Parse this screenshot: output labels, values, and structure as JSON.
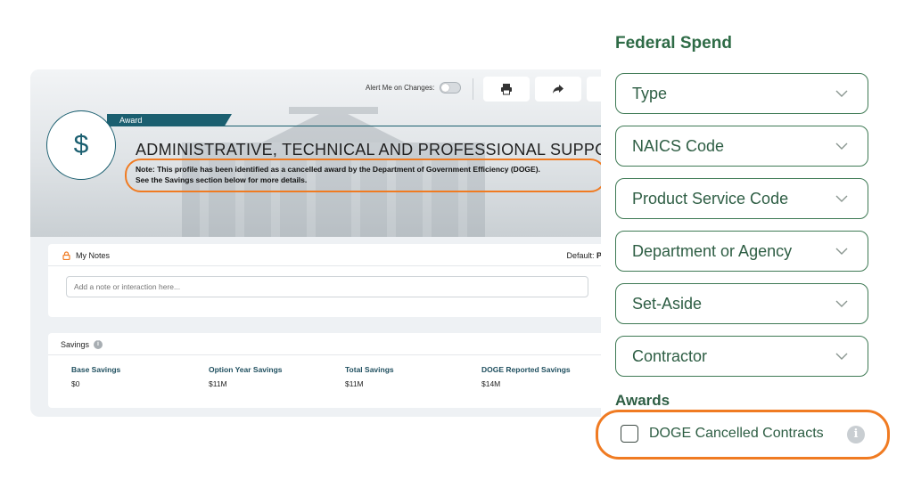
{
  "profile": {
    "alert_label": "Alert Me on Changes:",
    "award_tab": "Award",
    "currency_symbol": "$",
    "title": "ADMINISTRATIVE, TECHNICAL AND PROFESSIONAL SUPPORT FOR",
    "note_line1": "Note: This profile has been identified as a cancelled award by the Department of Government Efficiency (DOGE).",
    "note_line2": "See the Savings section below for more details."
  },
  "notes": {
    "title": "My Notes",
    "default_label": "Default: ",
    "default_value": "Privat",
    "placeholder": "Add a note or interaction here..."
  },
  "savings": {
    "title": "Savings",
    "items": [
      {
        "label": "Base Savings",
        "value": "$0"
      },
      {
        "label": "Option Year Savings",
        "value": "$11M"
      },
      {
        "label": "Total Savings",
        "value": "$11M"
      },
      {
        "label": "DOGE Reported Savings",
        "value": "$14M"
      }
    ]
  },
  "filters": {
    "title": "Federal Spend",
    "items": [
      {
        "label": "Type"
      },
      {
        "label": "NAICS Code"
      },
      {
        "label": "Product Service Code"
      },
      {
        "label": "Department or Agency"
      },
      {
        "label": "Set-Aside"
      },
      {
        "label": "Contractor"
      }
    ],
    "awards_title": "Awards",
    "doge_checkbox_label": "DOGE Cancelled Contracts"
  },
  "colors": {
    "highlight": "#f07b22",
    "filter_green": "#3f7a55",
    "award_teal": "#1b5f70"
  }
}
